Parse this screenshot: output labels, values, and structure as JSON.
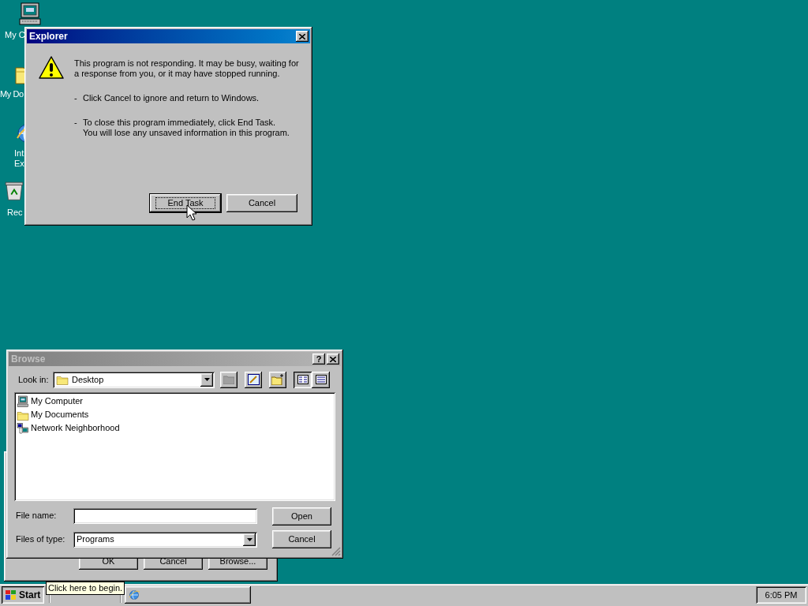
{
  "desktop_icons": [
    {
      "kind": "computer",
      "lines": [
        "My C"
      ]
    },
    {
      "kind": "documents",
      "lines": [
        "My Do"
      ]
    },
    {
      "kind": "browser",
      "lines": [
        "Int",
        "Ex"
      ]
    },
    {
      "kind": "recycle",
      "lines": [
        "Rec"
      ]
    }
  ],
  "explorer_dialog": {
    "title": "Explorer",
    "message": "This program is not responding. It may be busy, waiting for a response from you, or it may have stopped running.",
    "bullets": [
      {
        "marker": "-",
        "lines": [
          "Click Cancel to ignore and return to Windows."
        ]
      },
      {
        "marker": "-",
        "lines": [
          "To close this program immediately, click End Task.",
          "You will lose any unsaved information in this program."
        ]
      }
    ],
    "buttons": [
      {
        "label": "End Task",
        "focused": true
      },
      {
        "label": "Cancel",
        "focused": false
      }
    ]
  },
  "back_dialog": {
    "buttons": [
      "OK",
      "Cancel",
      "Browse..."
    ]
  },
  "browse_dialog": {
    "title": "Browse",
    "active": false,
    "help_button": "?",
    "look_in_label": "Look in:",
    "look_in_value": "Desktop",
    "items": [
      {
        "kind": "computer",
        "name": "My Computer"
      },
      {
        "kind": "documents",
        "name": "My Documents"
      },
      {
        "kind": "network",
        "name": "Network Neighborhood"
      }
    ],
    "file_name_label": "File name:",
    "files_of_type_label": "Files of type:",
    "files_of_type_value": "Programs",
    "buttons": [
      "Open",
      "Cancel"
    ]
  },
  "taskbar": {
    "start": "Start",
    "tooltip": "Click here to begin.",
    "tasks": [
      {
        "kind": "browser",
        "selected": false
      }
    ],
    "clock": "6:05 PM"
  }
}
